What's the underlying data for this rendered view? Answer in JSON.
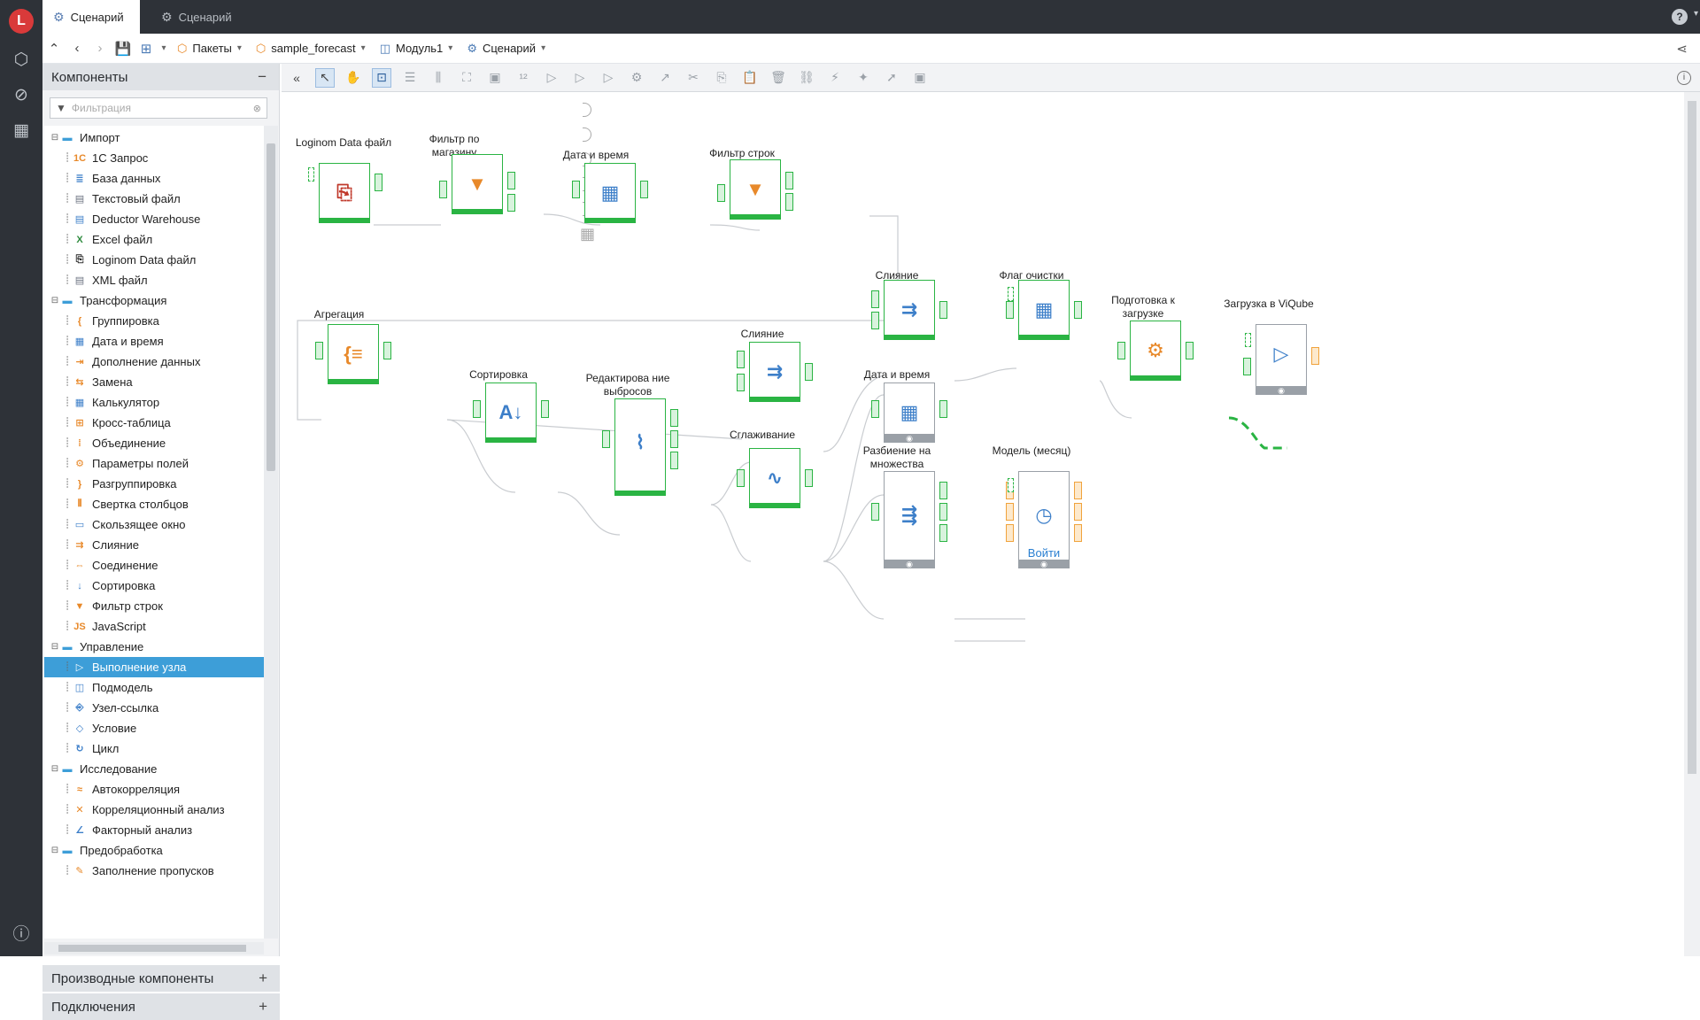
{
  "app": {
    "logo_text": "L",
    "accent": "#2ab443",
    "selection": "#3d9ed8"
  },
  "rail": {
    "icons": [
      "cube-icon",
      "compass-icon",
      "table-icon",
      "info-icon"
    ]
  },
  "tabs": [
    {
      "label": "Сценарий",
      "icon": "workflow-icon",
      "active": true
    },
    {
      "label": "Сценарий",
      "icon": "workflow-icon",
      "active": false
    }
  ],
  "help": {
    "label": "?"
  },
  "breadcrumbs": [
    {
      "label": "Пакеты",
      "icon": "package-icon"
    },
    {
      "label": "sample_forecast",
      "icon": "package-icon"
    },
    {
      "label": "Модуль1",
      "icon": "module-icon"
    },
    {
      "label": "Сценарий",
      "icon": "workflow-icon"
    }
  ],
  "panel": {
    "title": "Компоненты",
    "filter_placeholder": "Фильтрация",
    "derived": "Производные компоненты",
    "connections": "Подключения",
    "tree": [
      {
        "label": "Импорт",
        "level": 0,
        "icon": "folder-icon"
      },
      {
        "label": "1С Запрос",
        "level": 1,
        "icon": "1c-icon"
      },
      {
        "label": "База данных",
        "level": 1,
        "icon": "database-icon"
      },
      {
        "label": "Текстовый файл",
        "level": 1,
        "icon": "text-file-icon"
      },
      {
        "label": "Deductor Warehouse",
        "level": 1,
        "icon": "warehouse-icon"
      },
      {
        "label": "Excel файл",
        "level": 1,
        "icon": "excel-icon"
      },
      {
        "label": "Loginom Data файл",
        "level": 1,
        "icon": "lgd-file-icon"
      },
      {
        "label": "XML файл",
        "level": 1,
        "icon": "xml-icon"
      },
      {
        "label": "Трансформация",
        "level": 0,
        "icon": "folder-icon"
      },
      {
        "label": "Группировка",
        "level": 1,
        "icon": "group-icon"
      },
      {
        "label": "Дата и время",
        "level": 1,
        "icon": "calendar-icon"
      },
      {
        "label": "Дополнение данных",
        "level": 1,
        "icon": "append-icon"
      },
      {
        "label": "Замена",
        "level": 1,
        "icon": "replace-icon"
      },
      {
        "label": "Калькулятор",
        "level": 1,
        "icon": "calculator-icon"
      },
      {
        "label": "Кросс-таблица",
        "level": 1,
        "icon": "crosstab-icon"
      },
      {
        "label": "Объединение",
        "level": 1,
        "icon": "union-icon"
      },
      {
        "label": "Параметры полей",
        "level": 1,
        "icon": "field-params-icon"
      },
      {
        "label": "Разгруппировка",
        "level": 1,
        "icon": "ungroup-icon"
      },
      {
        "label": "Свертка столбцов",
        "level": 1,
        "icon": "unpivot-icon"
      },
      {
        "label": "Скользящее окно",
        "level": 1,
        "icon": "sliding-window-icon"
      },
      {
        "label": "Слияние",
        "level": 1,
        "icon": "merge-icon"
      },
      {
        "label": "Соединение",
        "level": 1,
        "icon": "join-icon"
      },
      {
        "label": "Сортировка",
        "level": 1,
        "icon": "sort-icon"
      },
      {
        "label": "Фильтр строк",
        "level": 1,
        "icon": "filter-icon"
      },
      {
        "label": "JavaScript",
        "level": 1,
        "icon": "js-icon"
      },
      {
        "label": "Управление",
        "level": 0,
        "icon": "folder-icon"
      },
      {
        "label": "Выполнение узла",
        "level": 1,
        "icon": "execute-node-icon",
        "selected": true
      },
      {
        "label": "Подмодель",
        "level": 1,
        "icon": "submodel-icon"
      },
      {
        "label": "Узел-ссылка",
        "level": 1,
        "icon": "link-node-icon"
      },
      {
        "label": "Условие",
        "level": 1,
        "icon": "condition-icon"
      },
      {
        "label": "Цикл",
        "level": 1,
        "icon": "loop-icon"
      },
      {
        "label": "Исследование",
        "level": 0,
        "icon": "folder-icon"
      },
      {
        "label": "Автокорреляция",
        "level": 1,
        "icon": "autocorrelation-icon"
      },
      {
        "label": "Корреляционный анализ",
        "level": 1,
        "icon": "correlation-icon"
      },
      {
        "label": "Факторный анализ",
        "level": 1,
        "icon": "factor-icon"
      },
      {
        "label": "Предобработка",
        "level": 0,
        "icon": "folder-icon"
      },
      {
        "label": "Заполнение пропусков",
        "level": 1,
        "icon": "fill-missing-icon"
      }
    ]
  },
  "toolbar": {
    "icons": [
      "collapse-icon",
      "pointer-icon",
      "hand-icon",
      "fit-icon",
      "list-icon",
      "align-icon",
      "layout-icon",
      "group-icon",
      "numbering-icon",
      "run-icon",
      "step-icon",
      "step-over-icon",
      "gear-icon",
      "cursor-icon",
      "cut-icon",
      "copy-icon",
      "paste-icon",
      "delete-icon",
      "link-icon",
      "unlink-icon",
      "magic-icon",
      "pin-icon",
      "export-icon"
    ],
    "info": "i"
  },
  "nodes": {
    "lgd": {
      "label": "Loginom Data файл",
      "icon": "lgd-file-icon"
    },
    "filter_shop": {
      "label": "Фильтр по магазину",
      "icon": "filter-icon"
    },
    "datetime1": {
      "label": "Дата и время",
      "icon": "calendar-icon"
    },
    "filter_rows": {
      "label": "Фильтр строк",
      "icon": "filter-icon"
    },
    "aggregation": {
      "label": "Агрегация",
      "icon": "group-icon"
    },
    "sort": {
      "label": "Сортировка",
      "icon": "sort-icon"
    },
    "outliers": {
      "label": "Редактирова ние выбросов",
      "icon": "outliers-icon"
    },
    "merge1": {
      "label": "Слияние",
      "icon": "merge-icon"
    },
    "smoothing": {
      "label": "Сглаживание",
      "icon": "smoothing-icon"
    },
    "merge2": {
      "label": "Слияние",
      "icon": "merge-icon"
    },
    "datetime2": {
      "label": "Дата и время",
      "icon": "calendar-icon"
    },
    "split": {
      "label": "Разбиение на множества",
      "icon": "split-icon"
    },
    "flag": {
      "label": "Флаг очистки",
      "icon": "calculator-icon"
    },
    "prepare": {
      "label": "Подготовка к загрузке",
      "icon": "field-params-icon"
    },
    "model": {
      "label": "Модель (месяц)",
      "icon": "submodel-icon",
      "action": "Войти"
    },
    "viqube": {
      "label": "Загрузка в ViQube",
      "icon": "execute-node-icon"
    }
  }
}
